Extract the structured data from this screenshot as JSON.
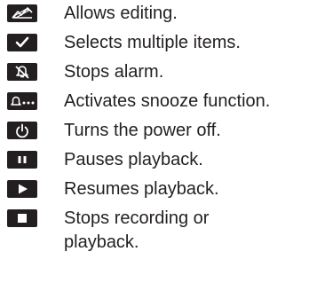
{
  "items": [
    {
      "icon": "edit-icon",
      "label": "Allows editing."
    },
    {
      "icon": "checkmark-icon",
      "label": "Selects multiple items."
    },
    {
      "icon": "alarm-off-icon",
      "label": "Stops alarm."
    },
    {
      "icon": "snooze-icon",
      "label": "Activates snooze function."
    },
    {
      "icon": "power-icon",
      "label": "Turns the power off."
    },
    {
      "icon": "pause-icon",
      "label": "Pauses playback."
    },
    {
      "icon": "play-icon",
      "label": "Resumes playback."
    },
    {
      "icon": "stop-icon",
      "label": "Stops recording or",
      "label_line2": "playback."
    }
  ],
  "colors": {
    "icon_bg": "#231f20",
    "icon_glyph": "#ffffff",
    "text": "#231f20"
  }
}
